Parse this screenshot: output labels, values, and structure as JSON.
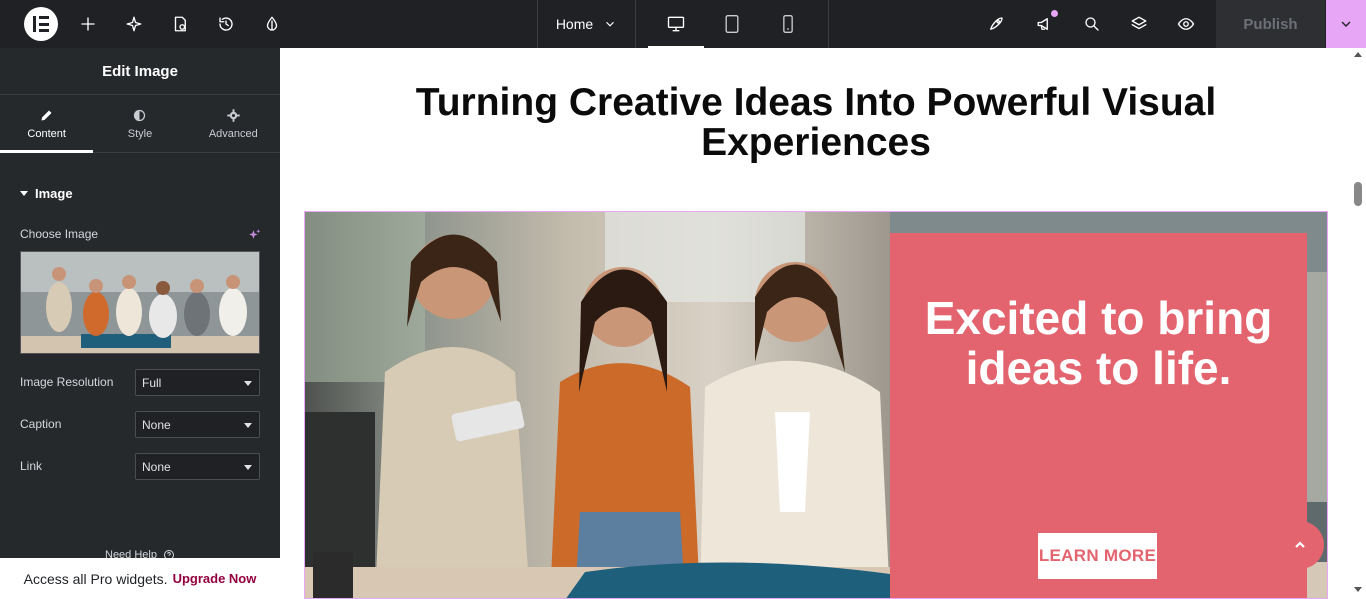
{
  "topbar": {
    "page_name": "Home",
    "publish_label": "Publish"
  },
  "panel": {
    "title": "Edit Image",
    "tabs": [
      {
        "label": "Content"
      },
      {
        "label": "Style"
      },
      {
        "label": "Advanced"
      }
    ],
    "section_title": "Image",
    "choose_image_label": "Choose Image",
    "fields": [
      {
        "label": "Image Resolution",
        "value": "Full"
      },
      {
        "label": "Caption",
        "value": "None"
      },
      {
        "label": "Link",
        "value": "None"
      }
    ],
    "need_help": "Need Help",
    "upgrade_text": "Access all Pro widgets.",
    "upgrade_link": "Upgrade Now"
  },
  "canvas": {
    "heading": "Turning Creative Ideas Into Powerful Visual Experiences",
    "card_text": "Excited to bring ideas to life.",
    "button_label": "LEARN MORE"
  },
  "colors": {
    "accent_pink": "#e3646e",
    "editor_dark": "#1f2124",
    "highlight": "#e8a6f7"
  }
}
